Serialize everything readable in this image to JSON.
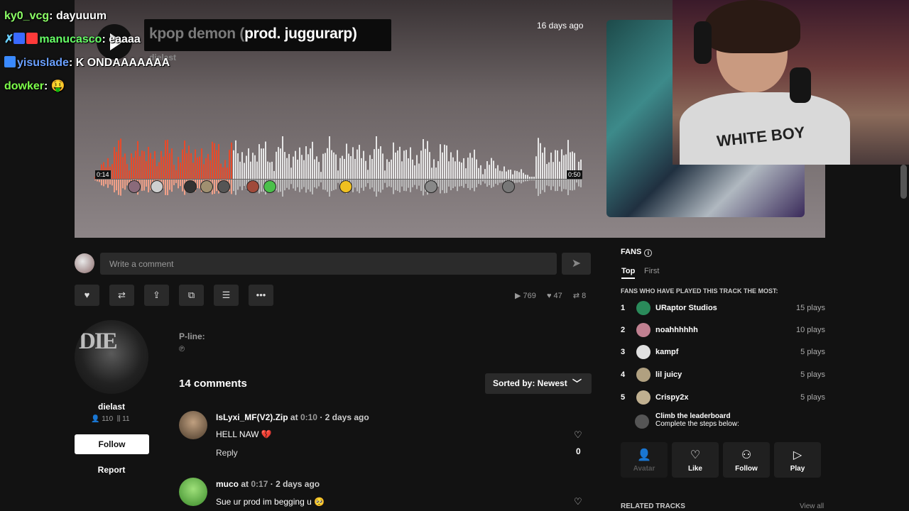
{
  "track": {
    "title_ghost": "kpop demon (",
    "title_main": "prod. juggurarp)",
    "artist_ghost": "dielast",
    "posted": "16 days ago",
    "time_current": "0:14",
    "time_total": "0:50",
    "progress": 0.28
  },
  "chat": [
    {
      "user": "ky0_vcg",
      "color": "#8cff66",
      "message": "dayuuum"
    },
    {
      "user": "manucasco",
      "color": "#66ff66",
      "message": "eaaaa"
    },
    {
      "user": "yisuslade",
      "color": "#6aa0ff",
      "message": "K ONDAAAAAAA"
    },
    {
      "user": "dowker",
      "color": "#7dff4a",
      "message": "🤑"
    }
  ],
  "webcam": {
    "shirt_text": "WHITE BOY"
  },
  "comment_box": {
    "placeholder": "Write a comment",
    "send_icon": "send-icon"
  },
  "actions": [
    "like-icon",
    "repost-icon",
    "share-icon",
    "copy-icon",
    "add-to-playlist-icon",
    "more-icon"
  ],
  "stats": {
    "plays": "769",
    "likes": "47",
    "reposts": "8"
  },
  "artist": {
    "name": "dielast",
    "followers": "110",
    "tracks": "11",
    "follow_label": "Follow",
    "report_label": "Report",
    "logo": "DIE"
  },
  "pline": {
    "label": "P-line:",
    "value": "℗"
  },
  "comments": {
    "count_label": "14 comments",
    "sort_label": "Sorted by: Newest",
    "items": [
      {
        "user": "IsLyxi_MF(V2).Zip",
        "at": "at",
        "time": "0:10",
        "ago": "· 2 days ago",
        "text": "HELL NAW 💔",
        "reply": "Reply",
        "likes": "0"
      },
      {
        "user": "muco",
        "at": "at",
        "time": "0:17",
        "ago": "· 2 days ago",
        "text": "Sue ur prod im begging u 🥺",
        "reply": "",
        "likes": ""
      }
    ]
  },
  "fans": {
    "title": "FANS",
    "tabs": [
      "Top",
      "First"
    ],
    "subtitle": "FANS WHO HAVE PLAYED THIS TRACK THE MOST:",
    "list": [
      {
        "rank": "1",
        "name": "URaptor Studios",
        "plays": "15 plays",
        "color": "#2a8a5a"
      },
      {
        "rank": "2",
        "name": "noahhhhhh",
        "plays": "10 plays",
        "color": "#c08090"
      },
      {
        "rank": "3",
        "name": "kampf",
        "plays": "5 plays",
        "color": "#e0e0e0"
      },
      {
        "rank": "4",
        "name": "lil juicy",
        "plays": "5 plays",
        "color": "#b0a080"
      },
      {
        "rank": "5",
        "name": "Crispy2x",
        "plays": "5 plays",
        "color": "#c0b090"
      }
    ],
    "climb_title": "Climb the leaderboard",
    "climb_sub": "Complete the steps below:",
    "steps": [
      {
        "label": "Avatar",
        "icon": "avatar-icon"
      },
      {
        "label": "Like",
        "icon": "heart-icon"
      },
      {
        "label": "Follow",
        "icon": "follow-user-icon"
      },
      {
        "label": "Play",
        "icon": "play-icon"
      }
    ],
    "related": "RELATED TRACKS",
    "view_all": "View all"
  }
}
